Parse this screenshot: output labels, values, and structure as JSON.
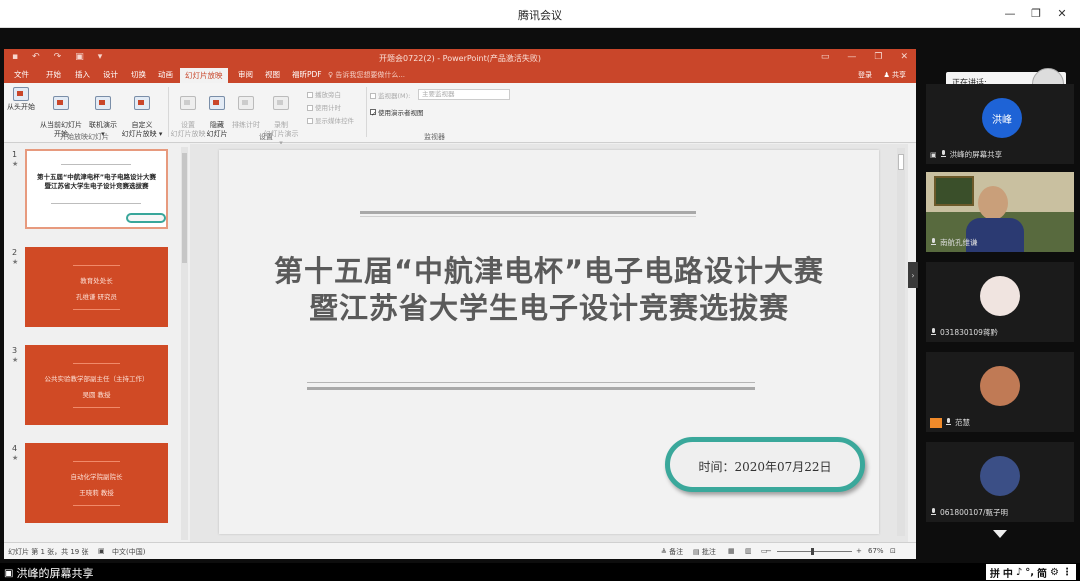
{
  "window": {
    "title": "腾讯会议",
    "controls": [
      "—",
      "❐",
      "✕"
    ]
  },
  "ppt": {
    "title": "开题会0722(2) - PowerPoint(产品激活失败)",
    "quick_access": [
      "▪",
      "↶",
      "↷",
      "▣",
      "▾"
    ],
    "win_controls": [
      "▭",
      "—",
      "❐",
      "✕"
    ],
    "tabs": [
      "文件",
      "开始",
      "插入",
      "设计",
      "切换",
      "动画",
      "幻灯片放映",
      "审阅",
      "视图",
      "福昕PDF"
    ],
    "active_tab": "幻灯片放映",
    "tell_me": "♀ 告诉我您想要做什么...",
    "login": "登录",
    "share": "♟ 共享",
    "ribbon": {
      "buttons": [
        {
          "label": "从头开始",
          "dim": false
        },
        {
          "label": "从当前幻灯片\n开始",
          "dim": false
        },
        {
          "label": "联机演示\n▾",
          "dim": false
        },
        {
          "label": "自定义\n幻灯片放映 ▾",
          "dim": false
        },
        {
          "label": "设置\n幻灯片放映",
          "dim": true
        },
        {
          "label": "隐藏\n幻灯片",
          "dim": false
        },
        {
          "label": "排练计时",
          "dim": true
        },
        {
          "label": "录制\n幻灯片演示 ▾",
          "dim": true
        }
      ],
      "checks": [
        {
          "label": "播放旁白",
          "on": false
        },
        {
          "label": "使用计时",
          "on": false
        },
        {
          "label": "显示媒体控件",
          "on": false
        }
      ],
      "monitor_label": "监视器(M):",
      "monitor_value": "主要监视器",
      "presenter_view": "使用演示者视图",
      "groups": [
        "开始放映幻灯片",
        "设置",
        "监视器"
      ]
    },
    "thumbnails": [
      {
        "num": "1",
        "star": "★",
        "title": "第十五届“中航津电杯”电子电路设计大赛\n暨江苏省大学生电子设计竞赛选拔赛"
      },
      {
        "num": "2",
        "star": "★",
        "line1": "教育处处长",
        "line2": "孔维谦 研究员"
      },
      {
        "num": "3",
        "star": "★",
        "line1": "公共实验教学部副主任（主持工作）",
        "line2": "吴圆 教授"
      },
      {
        "num": "4",
        "star": "★",
        "line1": "自动化学院副院长",
        "line2": "王晓莉 教授"
      }
    ],
    "slide": {
      "title_line1": "第十五届“中航津电杯”电子电路设计大赛",
      "title_line2": "暨江苏省大学生电子设计竞赛选拔赛",
      "date_label": "时间：2020年07月22日"
    },
    "status": {
      "slide_info": "幻灯片 第 1 张，共 19 张",
      "language": "中文(中国)",
      "notes": "≜ 备注",
      "comments": "▤ 批注",
      "zoom_minus": "−",
      "zoom_plus": "+",
      "zoom": "67%"
    }
  },
  "meeting": {
    "speaking_label": "正在讲话:",
    "participants": [
      {
        "name": "洪峰",
        "sub": "洪峰的屏幕共享",
        "avatar_text": "洪峰"
      },
      {
        "name": "南航孔维谦"
      },
      {
        "name": "031830109蒋黔"
      },
      {
        "name": "范慧"
      },
      {
        "name": "061800107/甄子明"
      }
    ],
    "share_label": "洪峰的屏幕共享",
    "ime": [
      "拼",
      "中",
      "♪",
      "°,",
      "简",
      "⚙",
      "⋮"
    ]
  },
  "colors": {
    "ppt_red": "#c9462a",
    "teal": "#3aa89b",
    "avatar_blue": "#1e63d6"
  }
}
